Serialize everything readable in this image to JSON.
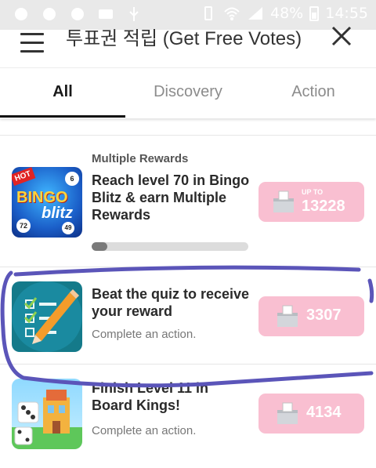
{
  "status_bar": {
    "battery": "48%",
    "time": "14:55"
  },
  "header": {
    "title": "투표권 적립 (Get Free Votes)"
  },
  "tabs": [
    {
      "label": "All"
    },
    {
      "label": "Discovery"
    },
    {
      "label": "Action"
    }
  ],
  "offers": [
    {
      "eyebrow": "Multiple Rewards",
      "title": "Reach level 70 in Bingo Blitz & earn Multiple Rewards",
      "progress": 0.1,
      "reward_prefix": "UP TO",
      "reward": "13228",
      "thumb_icon": "bingo-blitz-icon",
      "thumb_text": {
        "badge": "HOT",
        "line1": "BINGO",
        "line2": "blitz",
        "ball1": "6",
        "ball2": "72",
        "ball3": "49"
      }
    },
    {
      "title": "Beat the quiz to receive your reward",
      "subtitle": "Complete an action.",
      "reward": "3307",
      "thumb_icon": "quiz-checklist-icon"
    },
    {
      "title": "Finish Level 11 in Board Kings!",
      "subtitle": "Complete an action.",
      "reward": "4134",
      "thumb_icon": "board-kings-icon"
    }
  ],
  "colors": {
    "reward_pink": "#f9bfd1",
    "annotation": "#5b55b9"
  }
}
